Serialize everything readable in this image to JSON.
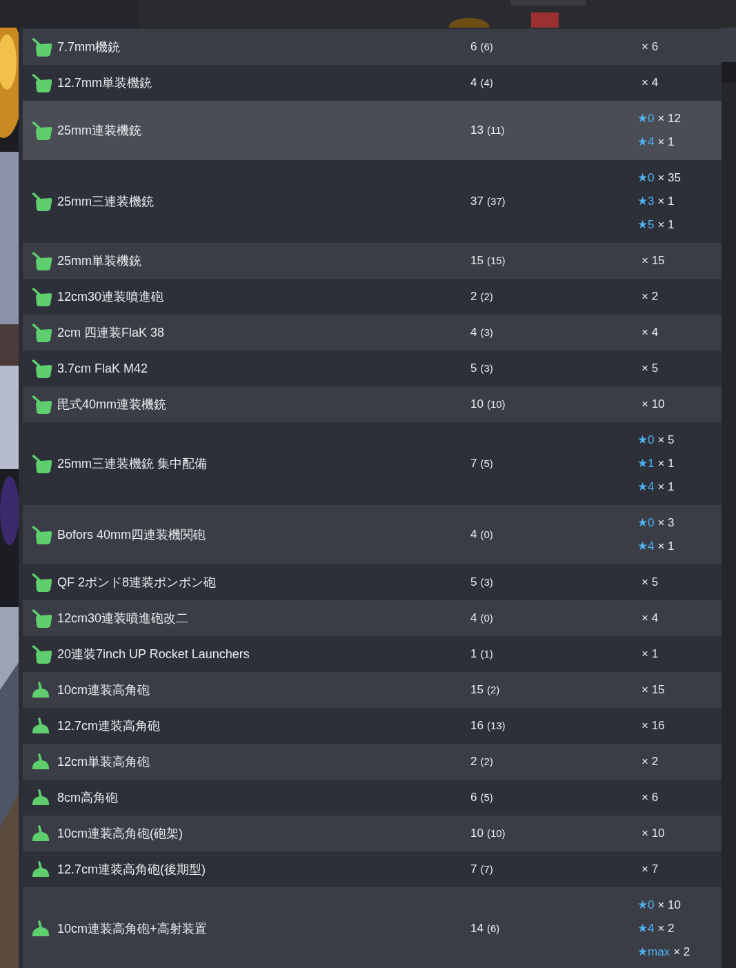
{
  "rows": [
    {
      "kind": "machine_gun",
      "name": "7.7mm機銃",
      "count": "6",
      "spare": "(6)",
      "highlighted": false,
      "upgrades": [
        {
          "count": "× 6"
        }
      ]
    },
    {
      "kind": "machine_gun",
      "name": "12.7mm単装機銃",
      "count": "4",
      "spare": "(4)",
      "highlighted": false,
      "upgrades": [
        {
          "count": "× 4"
        }
      ]
    },
    {
      "kind": "machine_gun",
      "name": "25mm連装機銃",
      "count": "13",
      "spare": "(11)",
      "highlighted": true,
      "upgrades": [
        {
          "star": "★0",
          "count": "× 12"
        },
        {
          "star": "★4",
          "count": "× 1"
        }
      ]
    },
    {
      "kind": "machine_gun",
      "name": "25mm三連装機銃",
      "count": "37",
      "spare": "(37)",
      "highlighted": false,
      "upgrades": [
        {
          "star": "★0",
          "count": "× 35"
        },
        {
          "star": "★3",
          "count": "× 1"
        },
        {
          "star": "★5",
          "count": "× 1"
        }
      ]
    },
    {
      "kind": "machine_gun",
      "name": "25mm単装機銃",
      "count": "15",
      "spare": "(15)",
      "highlighted": false,
      "upgrades": [
        {
          "count": "× 15"
        }
      ]
    },
    {
      "kind": "machine_gun",
      "name": "12cm30連装噴進砲",
      "count": "2",
      "spare": "(2)",
      "highlighted": false,
      "upgrades": [
        {
          "count": "× 2"
        }
      ]
    },
    {
      "kind": "machine_gun",
      "name": "2cm 四連装FlaK 38",
      "count": "4",
      "spare": "(3)",
      "highlighted": false,
      "upgrades": [
        {
          "count": "× 4"
        }
      ]
    },
    {
      "kind": "machine_gun",
      "name": "3.7cm FlaK M42",
      "count": "5",
      "spare": "(3)",
      "highlighted": false,
      "upgrades": [
        {
          "count": "× 5"
        }
      ]
    },
    {
      "kind": "machine_gun",
      "name": "毘式40mm連装機銃",
      "count": "10",
      "spare": "(10)",
      "highlighted": false,
      "upgrades": [
        {
          "count": "× 10"
        }
      ]
    },
    {
      "kind": "machine_gun",
      "name": "25mm三連装機銃 集中配備",
      "count": "7",
      "spare": "(5)",
      "highlighted": false,
      "upgrades": [
        {
          "star": "★0",
          "count": "× 5"
        },
        {
          "star": "★1",
          "count": "× 1"
        },
        {
          "star": "★4",
          "count": "× 1"
        }
      ]
    },
    {
      "kind": "machine_gun",
      "name": "Bofors 40mm四連装機関砲",
      "count": "4",
      "spare": "(0)",
      "highlighted": false,
      "upgrades": [
        {
          "star": "★0",
          "count": "× 3"
        },
        {
          "star": "★4",
          "count": "× 1"
        }
      ]
    },
    {
      "kind": "machine_gun",
      "name": "QF 2ポンド8連装ポンポン砲",
      "count": "5",
      "spare": "(3)",
      "highlighted": false,
      "upgrades": [
        {
          "count": "× 5"
        }
      ]
    },
    {
      "kind": "machine_gun",
      "name": "12cm30連装噴進砲改二",
      "count": "4",
      "spare": "(0)",
      "highlighted": false,
      "upgrades": [
        {
          "count": "× 4"
        }
      ]
    },
    {
      "kind": "machine_gun",
      "name": "20連装7inch UP Rocket Launchers",
      "count": "1",
      "spare": "(1)",
      "highlighted": false,
      "upgrades": [
        {
          "count": "× 1"
        }
      ]
    },
    {
      "kind": "high_angle",
      "name": "10cm連装高角砲",
      "count": "15",
      "spare": "(2)",
      "highlighted": false,
      "upgrades": [
        {
          "count": "× 15"
        }
      ]
    },
    {
      "kind": "high_angle",
      "name": "12.7cm連装高角砲",
      "count": "16",
      "spare": "(13)",
      "highlighted": false,
      "upgrades": [
        {
          "count": "× 16"
        }
      ]
    },
    {
      "kind": "high_angle",
      "name": "12cm単装高角砲",
      "count": "2",
      "spare": "(2)",
      "highlighted": false,
      "upgrades": [
        {
          "count": "× 2"
        }
      ]
    },
    {
      "kind": "high_angle",
      "name": "8cm高角砲",
      "count": "6",
      "spare": "(5)",
      "highlighted": false,
      "upgrades": [
        {
          "count": "× 6"
        }
      ]
    },
    {
      "kind": "high_angle",
      "name": "10cm連装高角砲(砲架)",
      "count": "10",
      "spare": "(10)",
      "highlighted": false,
      "upgrades": [
        {
          "count": "× 10"
        }
      ]
    },
    {
      "kind": "high_angle",
      "name": "12.7cm連装高角砲(後期型)",
      "count": "7",
      "spare": "(7)",
      "highlighted": false,
      "upgrades": [
        {
          "count": "× 7"
        }
      ]
    },
    {
      "kind": "high_angle",
      "name": "10cm連装高角砲+高射装置",
      "count": "14",
      "spare": "(6)",
      "highlighted": false,
      "upgrades": [
        {
          "star": "★0",
          "count": "× 10"
        },
        {
          "star": "★4",
          "count": "× 2"
        },
        {
          "star": "★max",
          "count": "× 2"
        }
      ]
    }
  ]
}
